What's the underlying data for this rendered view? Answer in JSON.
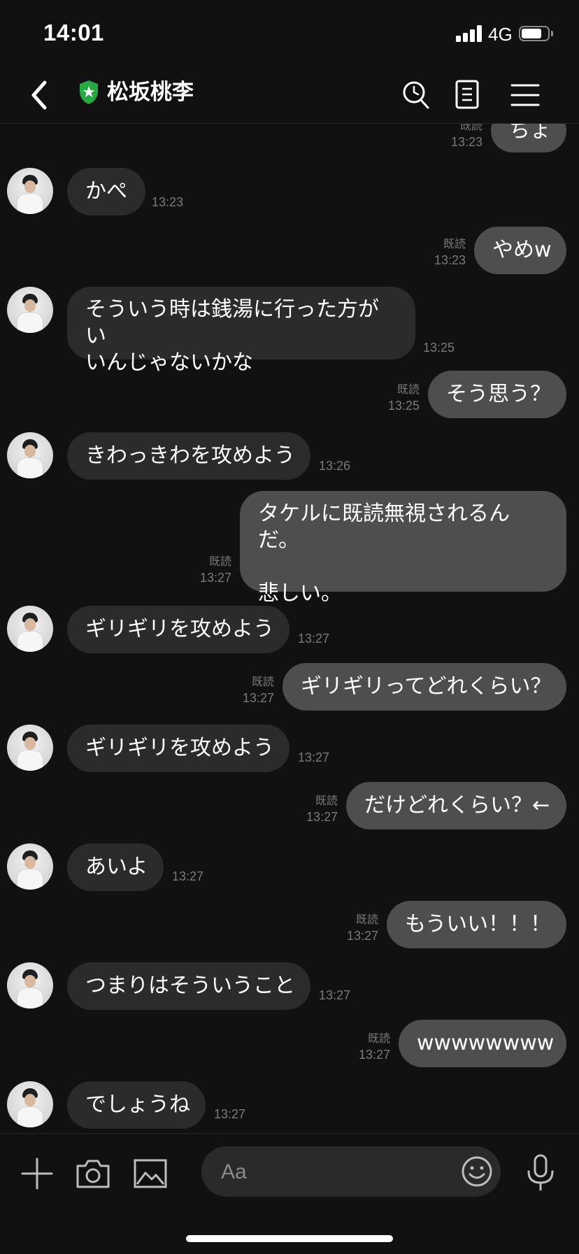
{
  "status_bar": {
    "time": "14:01",
    "network": "4G"
  },
  "header": {
    "contact_name": "松坂桃李",
    "icons": [
      "back-icon",
      "verified-shield-icon",
      "search-icon",
      "notes-icon",
      "menu-icon"
    ]
  },
  "messages": [
    {
      "side": "out",
      "text": "ちょ",
      "read": "既読",
      "time": "13:23"
    },
    {
      "side": "in",
      "text": "かぺ",
      "time": "13:23"
    },
    {
      "side": "out",
      "text": "やめw",
      "read": "既読",
      "time": "13:23"
    },
    {
      "side": "in",
      "lines": [
        "そういう時は銭湯に行った方がい",
        "いんじゃないかな"
      ],
      "time": "13:25"
    },
    {
      "side": "out",
      "text": "そう思う？",
      "read": "既読",
      "time": "13:25"
    },
    {
      "side": "in",
      "text": "きわっきわを攻めよう",
      "time": "13:26"
    },
    {
      "side": "out",
      "lines": [
        "タケルに既読無視されるんだ。",
        "",
        "悲しい。"
      ],
      "read": "既読",
      "time": "13:27"
    },
    {
      "side": "in",
      "text": "ギリギリを攻めよう",
      "time": "13:27"
    },
    {
      "side": "out",
      "text": "ギリギリってどれくらい？",
      "read": "既読",
      "time": "13:27"
    },
    {
      "side": "in",
      "text": "ギリギリを攻めよう",
      "time": "13:27"
    },
    {
      "side": "out",
      "text": "だけどれくらい？←",
      "read": "既読",
      "time": "13:27"
    },
    {
      "side": "in",
      "text": "あいよ",
      "time": "13:27"
    },
    {
      "side": "out",
      "text": "もういい！！！",
      "read": "既読",
      "time": "13:27"
    },
    {
      "side": "in",
      "text": "つまりはそういうこと",
      "time": "13:27"
    },
    {
      "side": "out",
      "text": "wwwwwwww",
      "read": "既読",
      "time": "13:27"
    },
    {
      "side": "in",
      "text": "でしょうね",
      "time": "13:27"
    }
  ],
  "input_bar": {
    "placeholder": "Aa",
    "icons": [
      "plus-icon",
      "camera-icon",
      "image-icon",
      "emoji-icon",
      "mic-icon"
    ]
  },
  "colors": {
    "background": "#111111",
    "bubble_incoming": "#2b2b2b",
    "bubble_outgoing": "#4e4e4e",
    "meta_text": "#7a7a7a",
    "verified_green": "#27a843"
  }
}
